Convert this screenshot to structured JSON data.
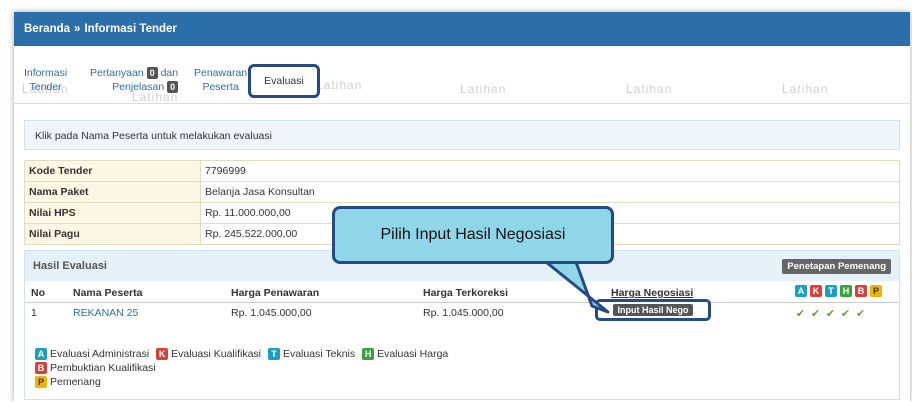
{
  "breadcrumb": {
    "home": "Beranda",
    "separator": "»",
    "current": "Informasi Tender"
  },
  "tabs": {
    "informasi": [
      "Informasi",
      "Tender"
    ],
    "pertanyaan": {
      "line1": "Pertanyaan",
      "count1": "0",
      "line1_suffix": "dan",
      "line2": "Penjelasan",
      "count2": "0"
    },
    "penawaran": [
      "Penawaran",
      "Peserta"
    ],
    "evaluasi": "Evaluasi"
  },
  "watermark": "Latihan",
  "notice": "Klik pada Nama Peserta untuk melakukan evaluasi",
  "details": [
    {
      "label": "Kode Tender",
      "value": "7796999"
    },
    {
      "label": "Nama Paket",
      "value": "Belanja Jasa Konsultan"
    },
    {
      "label": "Nilai HPS",
      "value": "Rp. 11.000.000,00"
    },
    {
      "label": "Nilai Pagu",
      "value": "Rp. 245.522.000,00"
    }
  ],
  "hasil": {
    "title": "Hasil Evaluasi",
    "penetapan_label": "Penetapan Pemenang",
    "columns": {
      "no": "No",
      "nama": "Nama Peserta",
      "penawaran": "Harga Penawaran",
      "terkoreksi": "Harga Terkoreksi",
      "negosiasi": "Harga Negosiasi"
    },
    "status_letters": [
      "A",
      "K",
      "T",
      "H",
      "B",
      "P"
    ],
    "rows": [
      {
        "no": "1",
        "nama": "REKANAN 25",
        "penawaran": "Rp. 1.045.000,00",
        "terkoreksi": "Rp. 1.045.000,00",
        "nego_button": "Input Hasil Nego",
        "checks": [
          "✔",
          "✔",
          "✔",
          "✔",
          "✔"
        ]
      }
    ]
  },
  "legend": {
    "A": "Evaluasi Administrasi",
    "K": "Evaluasi Kualifikasi",
    "T": "Evaluasi Teknis",
    "H": "Evaluasi Harga",
    "B": "Pembuktian Kualifikasi",
    "P": "Pemenang"
  },
  "callout": "Pilih Input Hasil Negosiasi",
  "colors": {
    "header": "#2a6faa",
    "highlight_border": "#254a84",
    "callout_fill": "#8fd6e8"
  }
}
